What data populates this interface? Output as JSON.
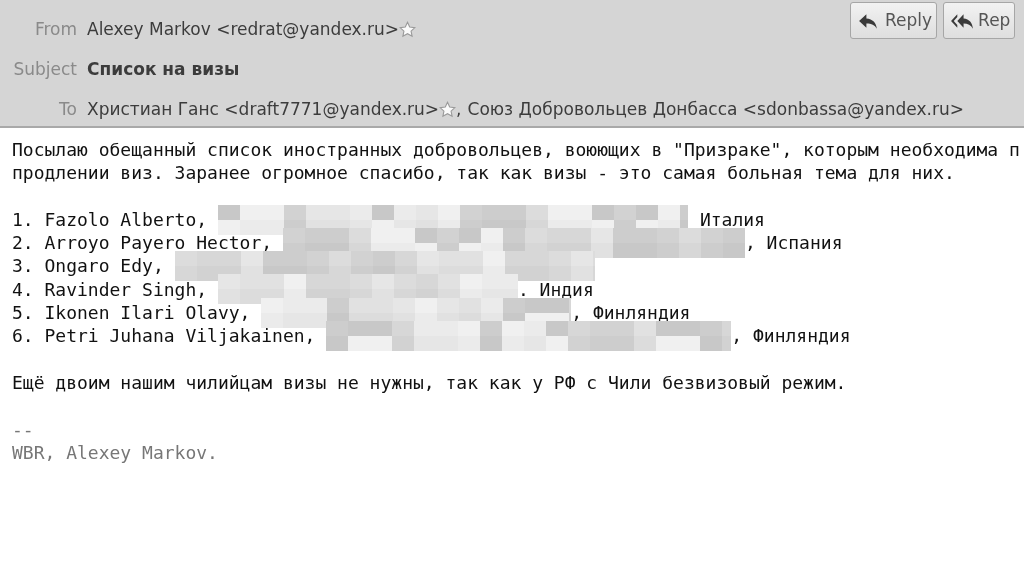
{
  "header": {
    "from": {
      "label": "From",
      "sender": {
        "text": "Alexey Markov <redrat@yandex.ru>",
        "starred": false
      }
    },
    "subject": {
      "label": "Subject",
      "text": "Список на визы"
    },
    "to": {
      "label": "To",
      "recipients": [
        {
          "text": "Христиан Ганс <draft7771@yandex.ru>",
          "starred": false,
          "separator": ","
        },
        {
          "text": "Союз Добровольцев Донбасса <sdonbassa@yandex.ru>"
        }
      ]
    },
    "buttons": [
      {
        "label": "Reply",
        "kind": "reply"
      },
      {
        "label": "Rep",
        "kind": "reply-all"
      }
    ]
  },
  "body": {
    "intro": [
      "Посылаю обещанный список иностранных добровольцев, воюющих в \"Призраке\", которым необходима п",
      "продлении виз. Заранее огромное спасибо, так как визы - это самая больная тема для них."
    ],
    "list": [
      {
        "text": "1. Fazolo Alberto,",
        "redacted": true,
        "after": "Италия"
      },
      {
        "text": "2. Arroyo Payero Hector,",
        "redacted": true,
        "after": ", Испания"
      },
      {
        "text": "3. Ongaro Edy,",
        "redacted": true
      },
      {
        "text": "4. Ravinder Singh,",
        "redacted": true,
        "after": ". Индия"
      },
      {
        "text": "5. Ikonen Ilari Olavy,",
        "redacted": true,
        "after": ", Финляндия"
      },
      {
        "text": "6. Petri Juhana Viljakainen,",
        "redacted": true,
        "after": ", Финляндия"
      }
    ],
    "note": "Ещё двоим нашим чилийцам визы не нужны, так как у РФ с Чили безвизовый режим.",
    "signature_separator": "--",
    "signature": "WBR, Alexey Markov."
  }
}
